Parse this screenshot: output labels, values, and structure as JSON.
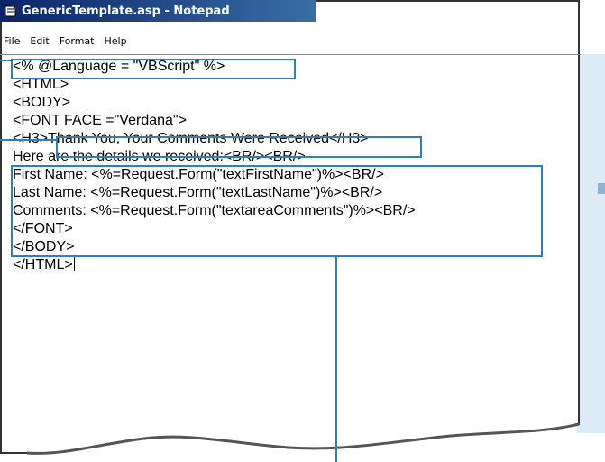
{
  "window": {
    "title": "GenericTemplate.asp - Notepad",
    "app_icon": "notepad-icon"
  },
  "menu": {
    "items": [
      "File",
      "Edit",
      "Format",
      "Help"
    ]
  },
  "editor": {
    "lines": [
      "<% @Language = \"VBScript\" %>",
      "<HTML>",
      "<BODY>",
      "<FONT FACE =\"Verdana\">",
      "<H3>Thank You, Your Comments Were Received</H3>",
      "Here are the details we received:<BR/><BR/>",
      "First Name: <%=Request.Form(\"textFirstName\")%><BR/>",
      "Last Name: <%=Request.Form(\"textLastName\")%><BR/>",
      "Comments: <%=Request.Form(\"textareaComments\")%><BR/>",
      "</FONT>",
      "</BODY>",
      "</HTML>"
    ],
    "caret_after_line": 12
  },
  "colors": {
    "callout": "#2f7fbf",
    "titlebar_start": "#0a246a",
    "titlebar_end": "#3a6ea5",
    "side_panel": "#dcebf6"
  }
}
